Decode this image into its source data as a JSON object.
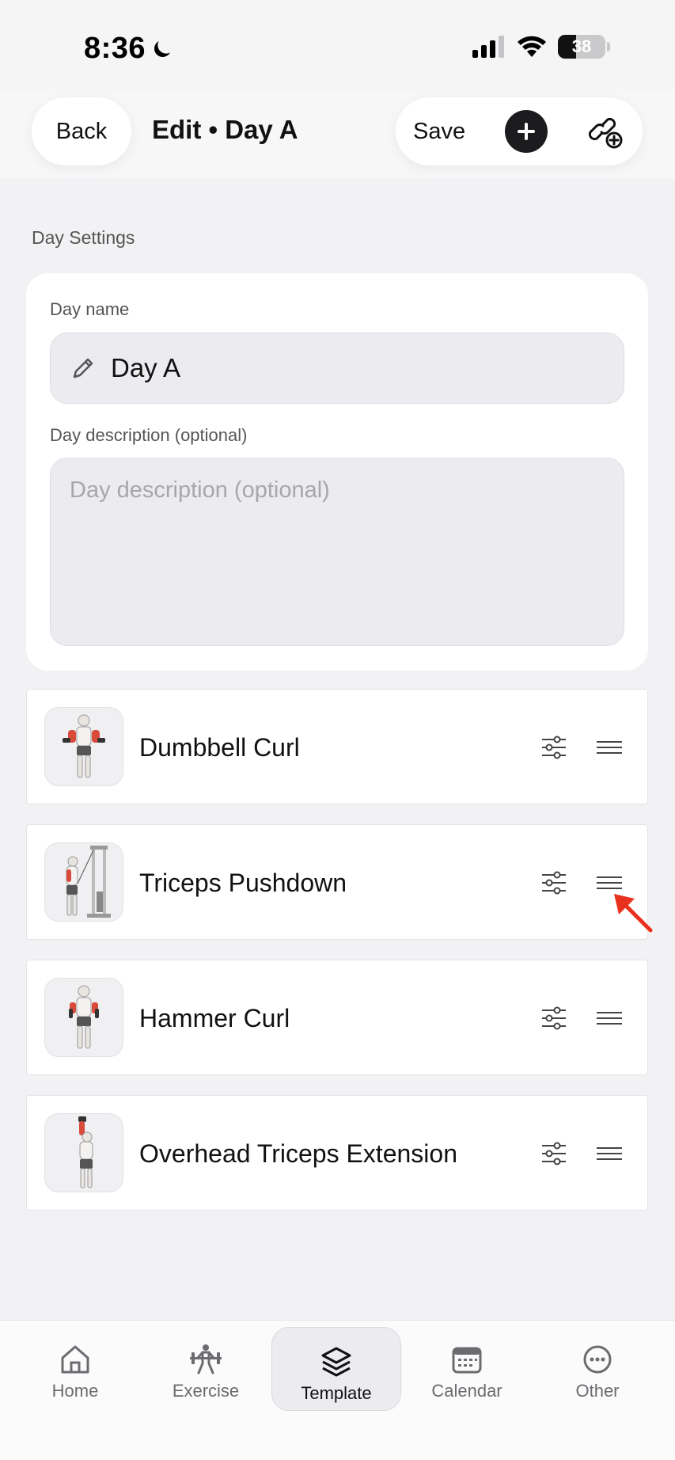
{
  "status": {
    "time": "8:36",
    "battery": "38"
  },
  "nav": {
    "back_label": "Back",
    "title": "Edit • Day A",
    "save_label": "Save"
  },
  "section_label": "Day Settings",
  "day_settings": {
    "name_label": "Day name",
    "name_value": "Day A",
    "description_label": "Day description (optional)",
    "description_placeholder": "Day description (optional)",
    "description_value": ""
  },
  "exercises": [
    {
      "name": "Dumbbell Curl",
      "icon": "dumbbell-curl-figure"
    },
    {
      "name": "Triceps Pushdown",
      "icon": "cable-pushdown-figure"
    },
    {
      "name": "Hammer Curl",
      "icon": "hammer-curl-figure"
    },
    {
      "name": "Overhead Triceps Extension",
      "icon": "overhead-extension-figure"
    }
  ],
  "tabs": [
    {
      "label": "Home",
      "icon": "house-icon"
    },
    {
      "label": "Exercise",
      "icon": "weightlifter-icon"
    },
    {
      "label": "Template",
      "icon": "layers-icon",
      "active": true
    },
    {
      "label": "Calendar",
      "icon": "calendar-icon"
    },
    {
      "label": "Other",
      "icon": "more-icon"
    }
  ],
  "colors": {
    "accent_dark": "#1c1c1e",
    "annotation_arrow": "#e8321e",
    "background": "#f2f2f4"
  }
}
